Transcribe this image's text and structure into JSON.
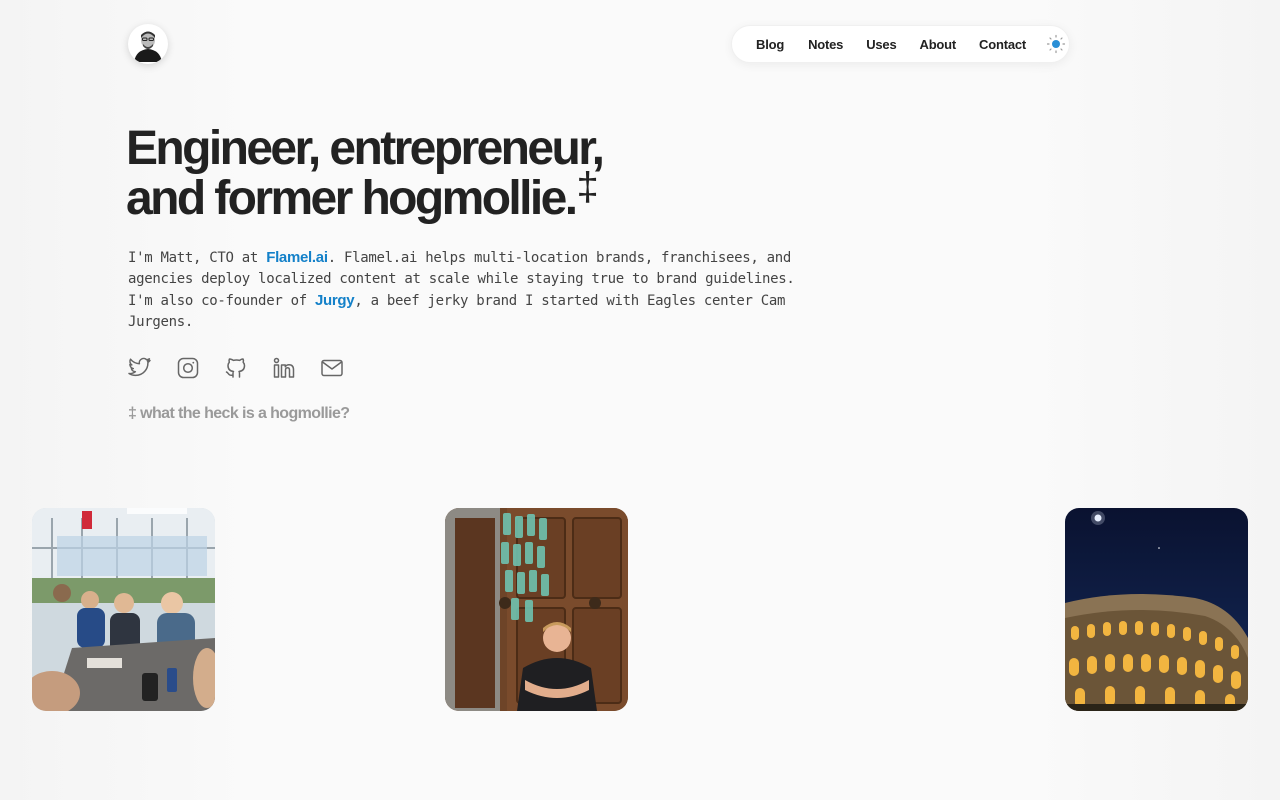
{
  "header": {
    "avatar_icon": "portrait-avatar",
    "nav": {
      "items": [
        {
          "label": "Blog"
        },
        {
          "label": "Notes"
        },
        {
          "label": "Uses"
        },
        {
          "label": "About"
        },
        {
          "label": "Contact"
        }
      ],
      "theme_toggle_icon": "sun-icon"
    }
  },
  "hero": {
    "headline_line1": "Engineer, entrepreneur,",
    "headline_line2": "and former hogmollie.",
    "headline_mark": "‡",
    "intro": {
      "p1_before": "I'm Matt, CTO at ",
      "p1_link": "Flamel.ai",
      "p1_after": ". Flamel.ai helps multi-location brands, franchisees, and agencies deploy localized content at scale while staying true to brand guidelines.",
      "p2_before": "I'm also co-founder of ",
      "p2_link": "Jurgy",
      "p2_after": ", a beef jerky brand I started with Eagles center Cam Jurgens."
    },
    "socials": [
      {
        "icon": "twitter-icon"
      },
      {
        "icon": "instagram-icon"
      },
      {
        "icon": "github-icon"
      },
      {
        "icon": "linkedin-icon"
      },
      {
        "icon": "mail-icon"
      }
    ],
    "footnote": "‡ what the heck is a hogmollie?"
  },
  "photos": [
    {
      "subject": "group-at-table-photo"
    },
    {
      "subject": "man-by-wooden-door-photo"
    },
    {
      "subject": "colosseum-at-night-photo"
    }
  ],
  "colors": {
    "link": "#1481c9",
    "text": "#222222",
    "muted": "#9a9a9a",
    "background": "#fafafa"
  }
}
